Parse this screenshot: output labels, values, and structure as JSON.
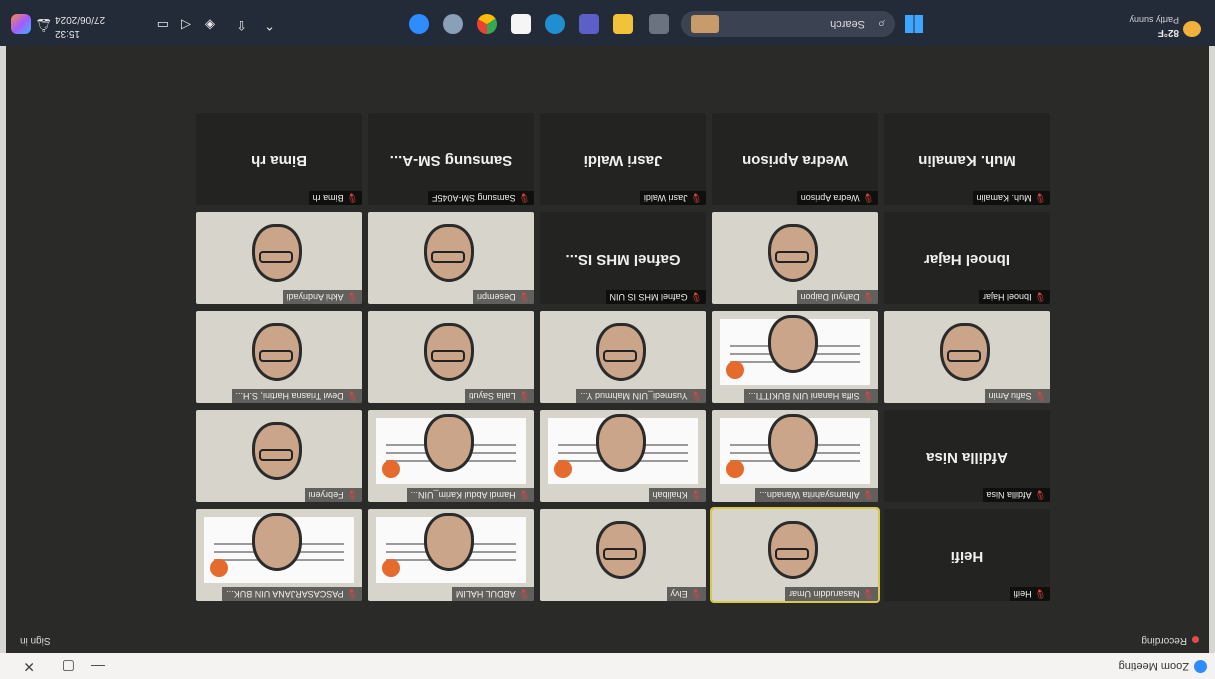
{
  "window": {
    "app_title": "Zoom Meeting",
    "controls": {
      "minimize": "—",
      "maximize": "▢",
      "close": "✕"
    }
  },
  "meeting": {
    "recording_label": "Recording",
    "sign_in_label": "Sign in",
    "tiles": [
      {
        "id": "heifi",
        "display": "Heifi",
        "label": "Heifi",
        "kind": "name"
      },
      {
        "id": "nasaruddin",
        "label": "Nasaruddin Umar",
        "kind": "video",
        "highlight": true
      },
      {
        "id": "elvy",
        "label": "Elvy",
        "kind": "video"
      },
      {
        "id": "abdul-halim",
        "label": "ABDUL HALIM",
        "kind": "slide"
      },
      {
        "id": "pascasarjana",
        "label": "PASCASARJANA UIN BUK...",
        "kind": "slide"
      },
      {
        "id": "afdilla",
        "display": "Afdilla Nisa",
        "label": "Afdilla Nisa",
        "kind": "name"
      },
      {
        "id": "alhamsyahrita",
        "label": "Alhamsyahrita Wanadn...",
        "kind": "slide"
      },
      {
        "id": "khalibah",
        "label": "Khalibah",
        "kind": "slide"
      },
      {
        "id": "hamdi",
        "label": "Hamdi Abdul Karim_UIN...",
        "kind": "slide"
      },
      {
        "id": "febryeni",
        "label": "Febryeni",
        "kind": "video"
      },
      {
        "id": "safiu",
        "label": "Safiu Amin",
        "kind": "video"
      },
      {
        "id": "siffa",
        "label": "Siffa Hanani UIN BUKITTI...",
        "kind": "slide"
      },
      {
        "id": "yusmedi",
        "label": "Yusmedi_UIN Mahmud Y...",
        "kind": "video"
      },
      {
        "id": "laila",
        "label": "Laila Sayuti",
        "kind": "video"
      },
      {
        "id": "dewi",
        "label": "Dewi Triasna Hartini, S.H...",
        "kind": "video"
      },
      {
        "id": "ibnoel",
        "display": "Ibnoel Hajar",
        "label": "Ibnoel Hajar",
        "kind": "name"
      },
      {
        "id": "dahyul",
        "label": "Dahyul Daipon",
        "kind": "video"
      },
      {
        "id": "gafnel",
        "display": "Gafnel MHS IS...",
        "label": "Gafnel MHS IS UIN",
        "kind": "name"
      },
      {
        "id": "desempri",
        "label": "Desempri",
        "kind": "video"
      },
      {
        "id": "akhi",
        "label": "Akhi Andriyadi",
        "kind": "video"
      },
      {
        "id": "kamalin",
        "display": "Muh. Kamalin",
        "label": "Muh. Kamalin",
        "kind": "name"
      },
      {
        "id": "wedra",
        "display": "Wedra Aprison",
        "label": "Wedra Aprison",
        "kind": "name"
      },
      {
        "id": "jasri",
        "display": "Jasri Waldi",
        "label": "Jasri Waldi",
        "kind": "name"
      },
      {
        "id": "samsung",
        "display": "Samsung SM-A...",
        "label": "Samsung SM-A045F",
        "kind": "name"
      },
      {
        "id": "bima",
        "display": "Bima rh",
        "label": "Bima rh",
        "kind": "name"
      }
    ]
  },
  "taskbar": {
    "weather_temp": "82°F",
    "weather_cond": "Partly sunny",
    "search_placeholder": "Search",
    "time": "15:32",
    "date": "27/06/2024",
    "tray_icons": [
      "chevron-up-icon",
      "upload-icon",
      "network-icon",
      "speaker-icon",
      "battery-icon"
    ],
    "apps": [
      "file-explorer-icon",
      "store-icon",
      "edge-icon",
      "folder-icon",
      "teams-icon",
      "chrome-icon",
      "settings-icon",
      "zoom-icon"
    ]
  }
}
